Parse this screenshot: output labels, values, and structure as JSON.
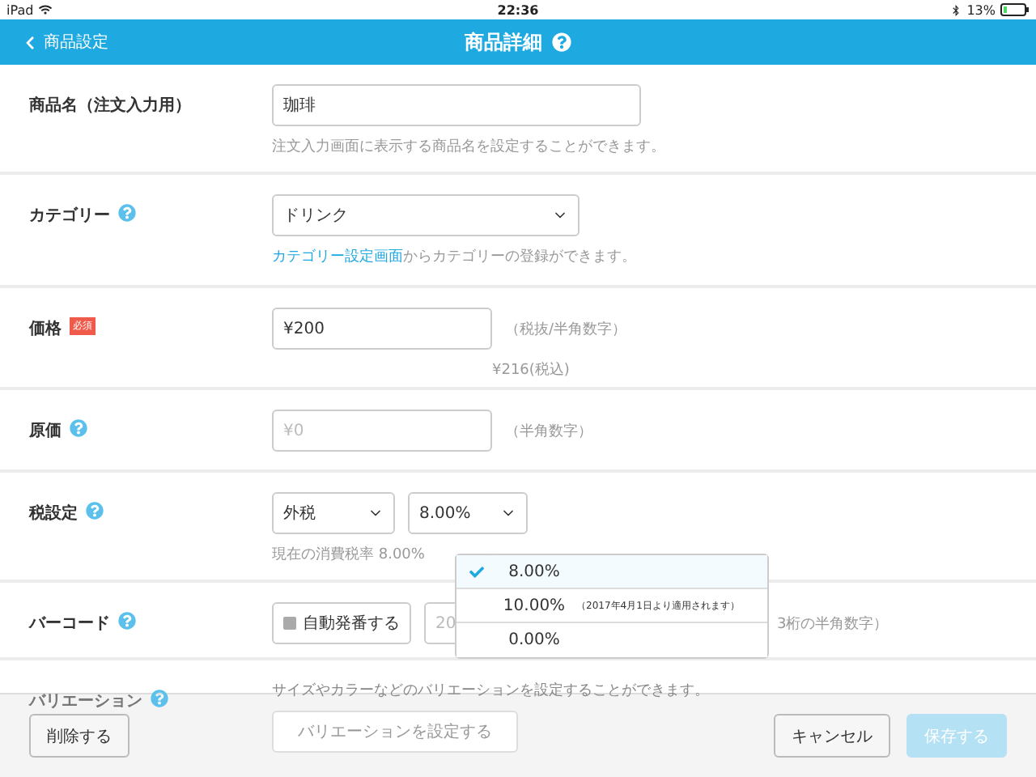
{
  "status_bar": {
    "device": "iPad",
    "time": "22:36",
    "battery": "13%"
  },
  "nav": {
    "back": "商品設定",
    "title": "商品詳細"
  },
  "rows": [
    {
      "kind": "text",
      "label": "商品名（注文入力用）",
      "help": false,
      "required": false,
      "value": "珈琲",
      "hint": "注文入力画面に表示する商品名を設定することができます。"
    },
    {
      "kind": "select",
      "label": "カテゴリー",
      "help": true,
      "required": false,
      "value": "ドリンク",
      "link": "カテゴリー設定画面",
      "hint": "からカテゴリーの登録ができます。"
    },
    {
      "kind": "price",
      "label": "価格",
      "help": false,
      "required": true,
      "required_label": "必須",
      "value": "¥200",
      "note": "（税抜/半角数字）",
      "sub": "¥216(税込)"
    },
    {
      "kind": "cost",
      "label": "原価",
      "help": true,
      "required": false,
      "placeholder": "¥0",
      "note": "（半角数字）"
    },
    {
      "kind": "tax",
      "label": "税設定",
      "help": true,
      "required": false,
      "tax_type": "外税",
      "rate": "8.00%",
      "hint": "現在の消費税率  8.00%"
    },
    {
      "kind": "barcode",
      "label": "バーコード",
      "help": true,
      "required": false,
      "auto": "自動発番する",
      "auto_checked": false,
      "placeholder": "20",
      "note": "3桁の半角数字）"
    },
    {
      "kind": "variation",
      "label": "バリエーション",
      "help": true,
      "required": false,
      "hint": "サイズやカラーなどのバリエーションを設定することができます。",
      "button": "バリエーションを設定する"
    }
  ],
  "rate_menu": [
    {
      "label": "8.00%",
      "selected": true
    },
    {
      "label": "10.00%",
      "note": "（2017年4月1日より適用されます）",
      "selected": false
    },
    {
      "label": "0.00%",
      "selected": false
    }
  ],
  "footer": {
    "delete": "削除する",
    "cancel": "キャンセル",
    "save": "保存する",
    "save_disabled": true
  }
}
